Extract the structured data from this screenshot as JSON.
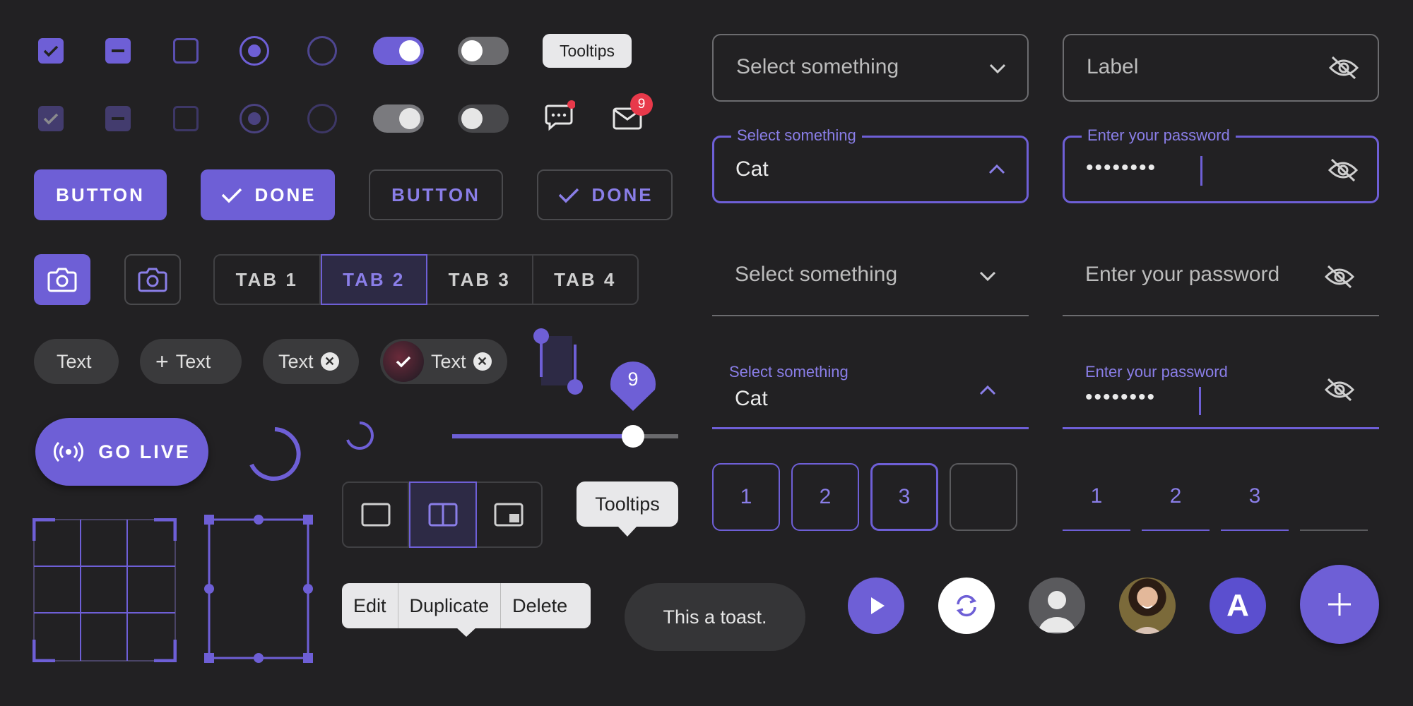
{
  "controls": {
    "tooltip_small": "Tooltips",
    "badge_count": "9"
  },
  "buttons": {
    "button": "BUTTON",
    "done": "DONE",
    "button_outline": "BUTTON",
    "done_outline": "DONE"
  },
  "tabs": [
    "TAB 1",
    "TAB 2",
    "TAB 3",
    "TAB 4"
  ],
  "chips": {
    "chip1": "Text",
    "chip2": "Text",
    "chip3": "Text",
    "chip4": "Text"
  },
  "slider": {
    "value_label": "9",
    "value_fraction": 0.8
  },
  "go_live": "GO LIVE",
  "tooltip_large": "Tooltips",
  "context_menu": [
    "Edit",
    "Duplicate",
    "Delete"
  ],
  "toast": "This a toast.",
  "avatar_letter": "A",
  "select_fields": {
    "outlined_placeholder": "Select something",
    "outlined_active_label": "Select something",
    "outlined_active_value": "Cat",
    "underline_placeholder": "Select something",
    "underline_active_label": "Select something",
    "underline_active_value": "Cat"
  },
  "password_fields": {
    "outlined_placeholder": "Label",
    "outlined_active_label": "Enter your password",
    "outlined_active_value": "••••••••",
    "underline_placeholder": "Enter your password",
    "underline_active_label": "Enter your password",
    "underline_active_value": "••••••••"
  },
  "otp_boxed": [
    "1",
    "2",
    "3",
    ""
  ],
  "otp_underlined": [
    "1",
    "2",
    "3",
    ""
  ],
  "colors": {
    "accent": "#6e5fd6",
    "background": "#222123",
    "badge": "#e8394a"
  }
}
